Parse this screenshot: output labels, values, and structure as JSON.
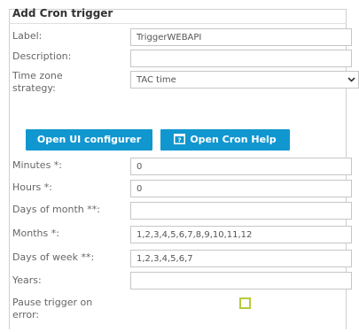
{
  "form": {
    "title": "Add Cron trigger",
    "label": {
      "label": "Label:",
      "value": "TriggerWEBAPI"
    },
    "description": {
      "label": "Description:",
      "value": ""
    },
    "timezone": {
      "label_line1": "Time zone",
      "label_line2": "strategy:",
      "value": "TAC time"
    },
    "buttons": {
      "ui_configurer": "Open UI configurer",
      "cron_help": "Open Cron Help"
    },
    "minutes": {
      "label": "Minutes *:",
      "value": "0"
    },
    "hours": {
      "label": "Hours *:",
      "value": "0"
    },
    "days_of_month": {
      "label": "Days of month **:",
      "value": ""
    },
    "months": {
      "label": "Months *:",
      "value": "1,2,3,4,5,6,7,8,9,10,11,12"
    },
    "days_of_week": {
      "label": "Days of week **:",
      "value": "1,2,3,4,5,6,7"
    },
    "years": {
      "label": "Years:",
      "value": ""
    },
    "pause": {
      "label_line1": "Pause trigger on",
      "label_line2": "error:",
      "checked": false
    }
  },
  "colors": {
    "button": "#1197cf",
    "checkbox_border": "#b7c93a"
  },
  "icons": {
    "cron_help": "calendar-help-icon",
    "select": "chevron-down-icon"
  }
}
